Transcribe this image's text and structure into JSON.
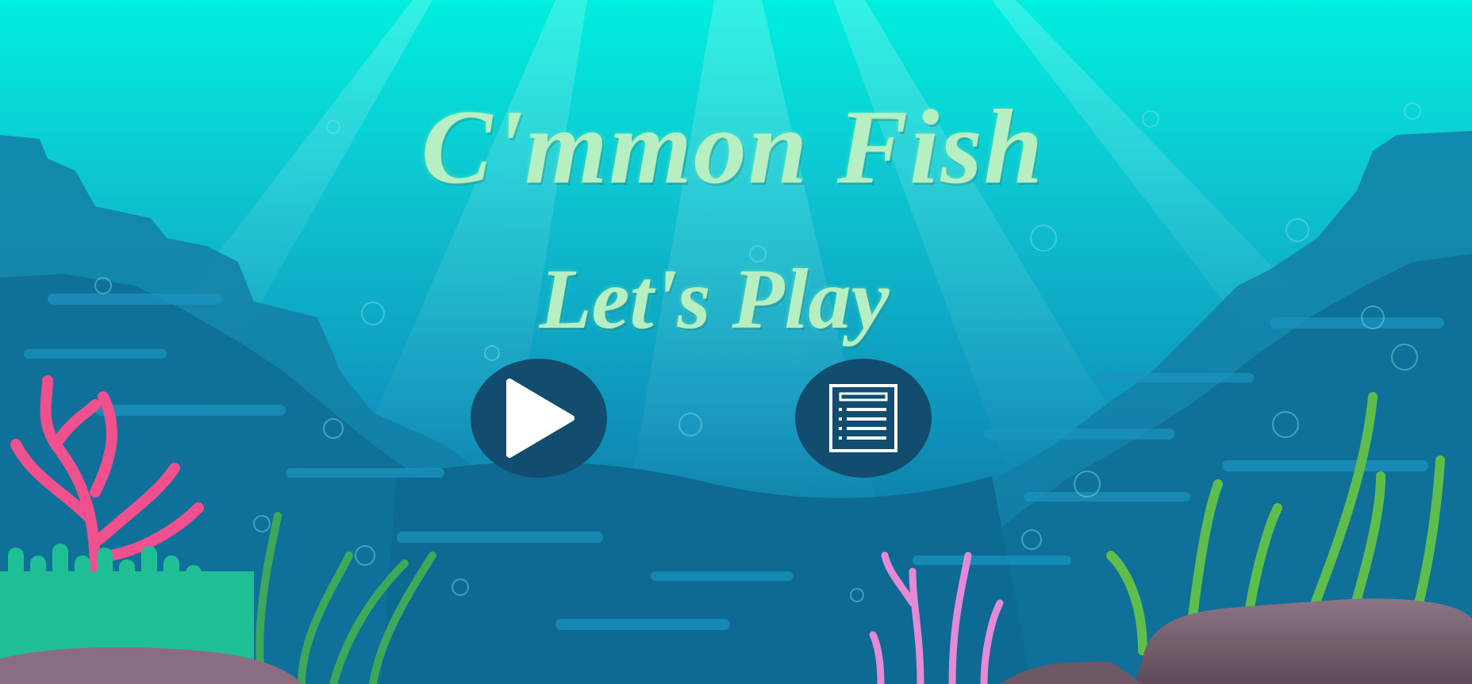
{
  "game": {
    "title": "C'mmon Fish",
    "subtitle": "Let's Play"
  },
  "buttons": {
    "play": {
      "icon": "play-icon"
    },
    "menu": {
      "icon": "list-icon"
    }
  },
  "colors": {
    "water_top": "#00efdf",
    "water_mid": "#10a9c6",
    "water_deep": "#0a5f87",
    "button_bg": "#124c6e",
    "title_text": "#b7efc3",
    "coral_pink": "#f0508e",
    "coral_violet": "#e48ad6",
    "seaweed_green": "#5fbd4c",
    "anemone_teal": "#1fbf96",
    "rock": "#7a6470"
  }
}
